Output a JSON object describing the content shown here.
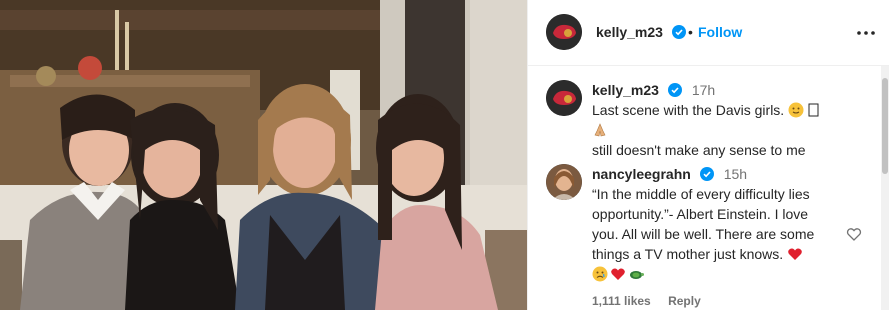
{
  "post": {
    "author": "kelly_m23",
    "verified": true,
    "follow_label": "Follow",
    "separator": "•",
    "more_icon": "more-options-icon"
  },
  "caption": {
    "author": "kelly_m23",
    "time": "17h",
    "line1": "Last scene with the Davis girls.",
    "line2": "still doesn't make any sense to me",
    "emojis": [
      "slight-smile-emoji",
      "missing-glyph",
      "folded-hands-emoji"
    ]
  },
  "comment": {
    "author": "nancyleegrahn",
    "time": "15h",
    "lines": [
      "“In the middle of every difficulty lies",
      "opportunity.”- Albert Einstein. I love",
      "you. All will be well. There are some",
      "things a TV mother just knows."
    ],
    "emojis": [
      "red-heart-emoji",
      "sad-face-emoji",
      "red-heart-emoji",
      "turtle-emoji"
    ],
    "likes": "1,111 likes",
    "reply_label": "Reply"
  },
  "colors": {
    "link": "#0095f6",
    "text": "#262626",
    "muted": "#737373",
    "verified": "#0095f6"
  }
}
